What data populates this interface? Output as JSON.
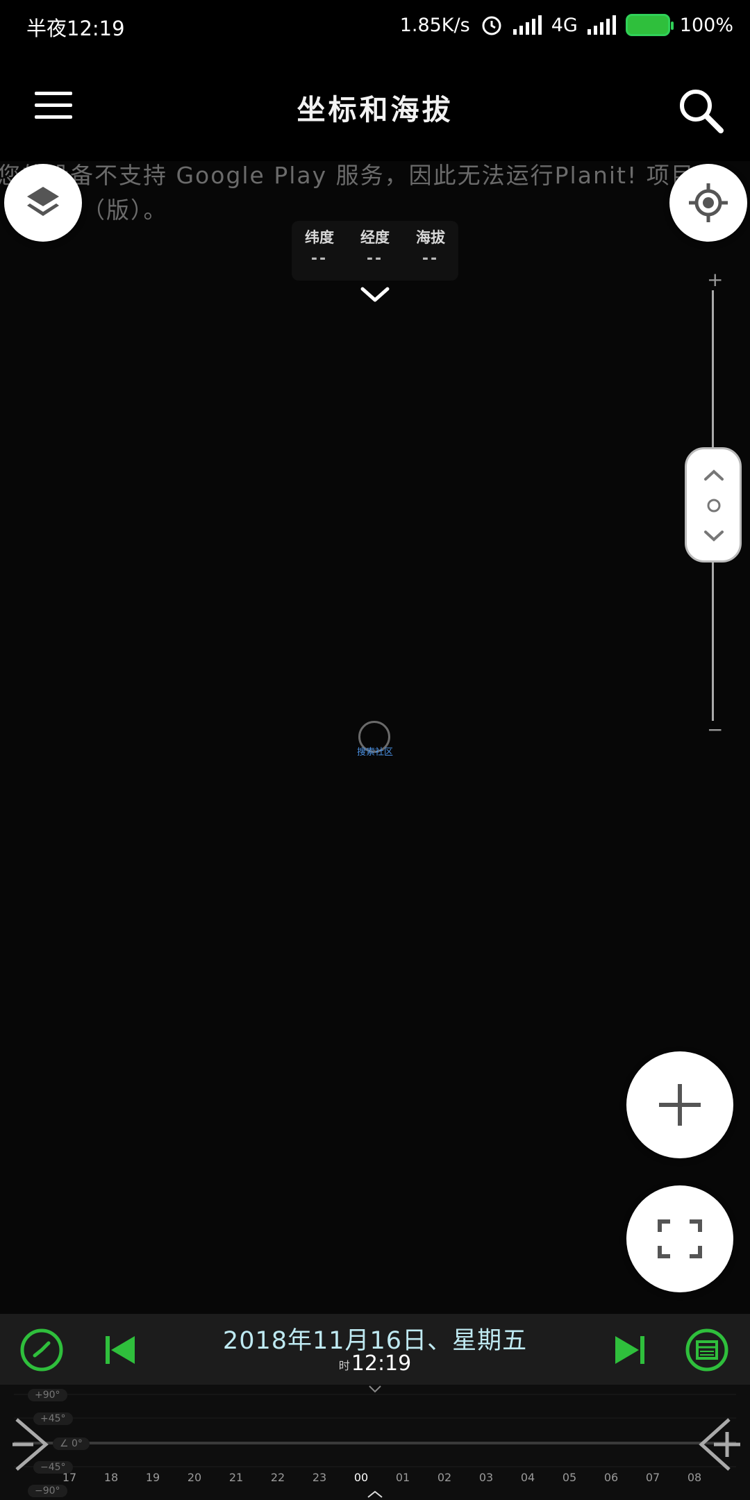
{
  "status_bar": {
    "time": "半夜12:19",
    "net_speed": "1.85K/s",
    "network": "4G",
    "battery": "100%"
  },
  "app_bar": {
    "title": "坐标和海拔"
  },
  "notice": {
    "line1": "您的设备不支持 Google Play 服务，因此无法运行Planit! 项目",
    "line2": "（版）。"
  },
  "coords": {
    "latitude_label": "纬度",
    "longitude_label": "经度",
    "altitude_label": "海拔",
    "latitude_value": "--",
    "longitude_value": "--",
    "altitude_value": "--"
  },
  "zoom": {
    "plus": "+",
    "minus": "−"
  },
  "map_center_label": "搜索社区",
  "bottom_bar": {
    "date": "2018年11月16日、星期五",
    "tz": "时",
    "time": "12:19"
  },
  "timeline": {
    "hours": [
      "17",
      "18",
      "19",
      "20",
      "21",
      "22",
      "23",
      "00",
      "01",
      "02",
      "03",
      "04",
      "05",
      "06",
      "07",
      "08"
    ],
    "angles": [
      "+90°",
      "+45°",
      "∠ 0°",
      "−45°",
      "−90°"
    ]
  },
  "colors": {
    "accent_green": "#2fbf3c",
    "date_text": "#bfeaf2"
  }
}
